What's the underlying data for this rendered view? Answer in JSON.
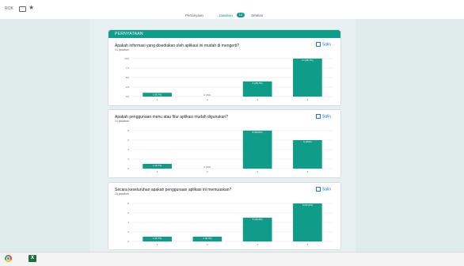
{
  "window": {
    "doc_title": "ROK"
  },
  "tabs": [
    {
      "label": "Pertanyaan"
    },
    {
      "label": "Jawaban",
      "badge": "14"
    },
    {
      "label": "Setelan"
    }
  ],
  "section": {
    "title": "PERNYATAAN"
  },
  "copy_label": "Salin",
  "questions": [
    {
      "text": "Apakah informasi yang disediakan oleh aplikasi ini mudah di mengerti?",
      "count": "14 jawaban",
      "chart_data": {
        "type": "bar",
        "categories": [
          "1",
          "2",
          "3",
          "4"
        ],
        "values": [
          1,
          0,
          4,
          10
        ],
        "bar_labels": [
          "1 (8,7%)",
          "0 (0%)",
          "4 (28,7%)",
          "10 (88,7%)"
        ],
        "y_ticks": [
          "0,0",
          "2,5",
          "5,0",
          "7,5",
          "10,0"
        ],
        "ylim": [
          0,
          10
        ]
      }
    },
    {
      "text": "Apakah penggunaan menu atau fitur aplikasi mudah digunakan?",
      "count": "14 jawaban",
      "chart_data": {
        "type": "bar",
        "categories": [
          "1",
          "2",
          "3",
          "4"
        ],
        "values": [
          1,
          0,
          8,
          6
        ],
        "bar_labels": [
          "1 (8,7%)",
          "0 (0%)",
          "8 (80,8%)",
          "6 (40%)"
        ],
        "y_ticks": [
          "0",
          "2",
          "4",
          "6",
          "8"
        ],
        "ylim": [
          0,
          8
        ]
      }
    },
    {
      "text": "Secara keseluruhan apakah penggunaan aplikasi ini memuaskan?",
      "count": "15 jawaban",
      "chart_data": {
        "type": "bar",
        "categories": [
          "1",
          "2",
          "3",
          "4"
        ],
        "values": [
          1,
          1,
          5,
          8
        ],
        "bar_labels": [
          "1 (8,7%)",
          "1 (8,7%)",
          "5 (33,3%)",
          "8 (53,3%)"
        ],
        "y_ticks": [
          "0",
          "2",
          "4",
          "6",
          "8"
        ],
        "ylim": [
          0,
          8
        ]
      }
    }
  ],
  "colors": {
    "accent": "#0f9d8a",
    "bar": "#0f9d8a",
    "page_bg": "#e0ecec"
  },
  "taskbar": {
    "apps": [
      "chrome-icon",
      "excel-icon"
    ],
    "excel_glyph": "X"
  }
}
